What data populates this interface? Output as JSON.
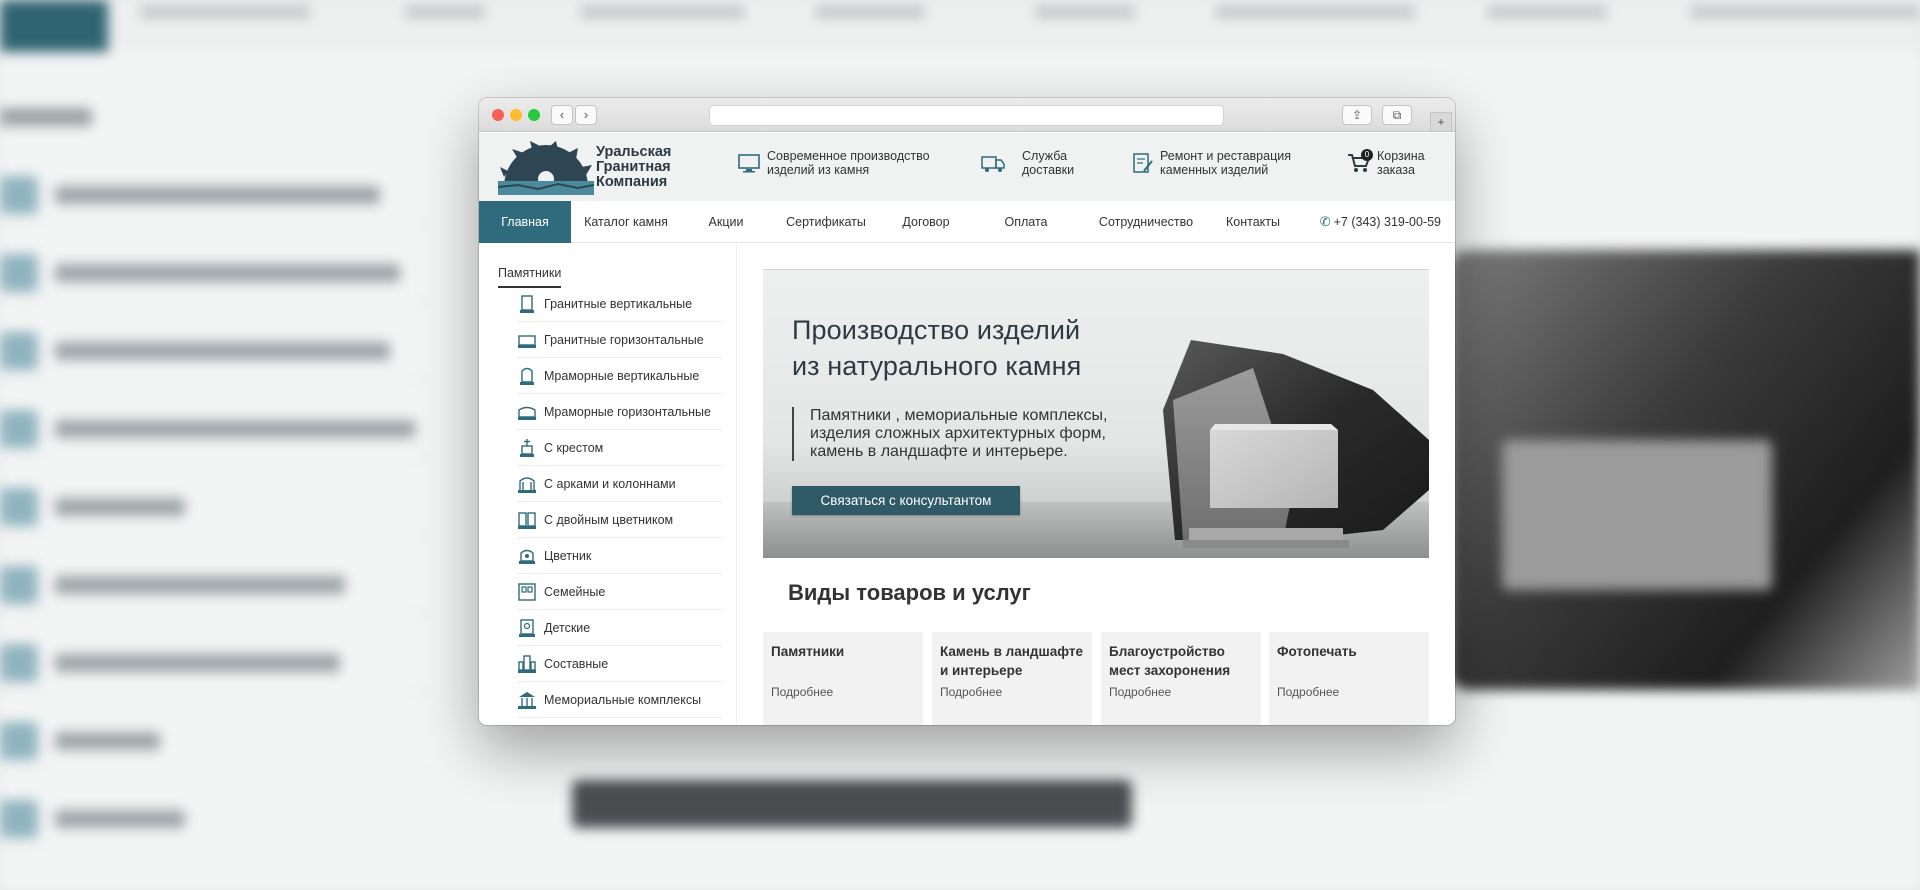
{
  "window": {
    "back_glyph": "‹",
    "forward_glyph": "›",
    "share_glyph": "⇪",
    "tabs_glyph": "⧉",
    "new_tab_glyph": "+"
  },
  "logo": {
    "line1": "Уральская",
    "line2": "Гранитная",
    "line3": "Компания"
  },
  "header_features": [
    {
      "icon": "monitor-icon",
      "line1": "Современное производство",
      "line2": "изделий из камня"
    },
    {
      "icon": "truck-icon",
      "line1": "Служба",
      "line2": "доставки"
    },
    {
      "icon": "repair-doc-icon",
      "line1": "Ремонт и реставрация",
      "line2": "каменных изделий"
    }
  ],
  "cart": {
    "count": "0",
    "line1": "Корзина",
    "line2": "заказа"
  },
  "nav": {
    "items": [
      "Главная",
      "Каталог камня",
      "Акции",
      "Сертификаты",
      "Договор",
      "Оплата",
      "Сотрудничество",
      "Контакты"
    ],
    "active_index": 0,
    "phone": "+7 (343) 319-00-59"
  },
  "sidebar": {
    "title": "Памятники",
    "items": [
      "Гранитные вертикальные",
      "Гранитные горизонтальные",
      "Мраморные вертикальные",
      "Мраморные горизонтальные",
      "С крестом",
      "С арками и колоннами",
      "С двойным цветником",
      "Цветник",
      "Семейные",
      "Детские",
      "Составные",
      "Мемориальные комплексы"
    ]
  },
  "banner": {
    "title_line1": "Производство изделий",
    "title_line2": "из натурального камня",
    "desc_line1": "Памятники , мемориальные комплексы,",
    "desc_line2": "изделия сложных архитектурных форм,",
    "desc_line3": "камень в ландшафте и интерьере.",
    "cta": "Связаться с консультантом"
  },
  "services": {
    "title": "Виды товаров и услуг",
    "more_label": "Подробнее",
    "cards": [
      {
        "line1": "Памятники",
        "line2": ""
      },
      {
        "line1": "Камень в ландшафте",
        "line2": "и интерьере"
      },
      {
        "line1": "Благоустройство",
        "line2": "мест захоронения"
      },
      {
        "line1": "Фотопечать",
        "line2": ""
      }
    ]
  },
  "colors": {
    "accent": "#2f6b7c",
    "cta": "#2f5a68",
    "header_bg": "#f0f1f1",
    "card_bg": "#f2f2f2"
  }
}
